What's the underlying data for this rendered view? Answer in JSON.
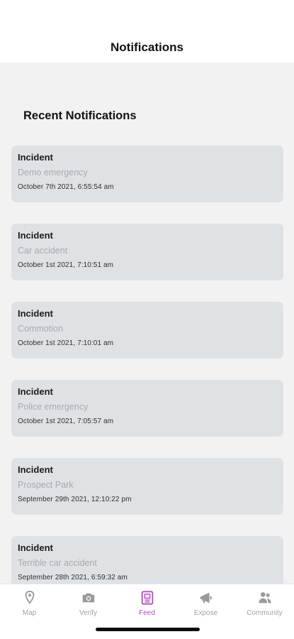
{
  "header": {
    "title": "Notifications"
  },
  "section": {
    "title": "Recent Notifications"
  },
  "notifications": [
    {
      "type": "Incident",
      "description": "Demo emergency",
      "time": "October 7th 2021, 6:55:54 am"
    },
    {
      "type": "Incident",
      "description": "Car accident",
      "time": "October 1st 2021, 7:10:51 am"
    },
    {
      "type": "Incident",
      "description": "Commotion",
      "time": "October 1st 2021, 7:10:01 am"
    },
    {
      "type": "Incident",
      "description": "Police emergency",
      "time": "October 1st 2021, 7:05:57 am"
    },
    {
      "type": "Incident",
      "description": "Prospect Park",
      "time": "September 29th 2021, 12:10:22 pm"
    },
    {
      "type": "Incident",
      "description": "Terrible car accident",
      "time": "September 28th 2021, 6:59:32 am"
    }
  ],
  "tabbar": {
    "active": "Feed",
    "active_color": "#b44cc4",
    "inactive_color": "#a2a2a6",
    "tabs": [
      {
        "label": "Map",
        "icon": "map-pin-icon"
      },
      {
        "label": "Verify",
        "icon": "camera-icon"
      },
      {
        "label": "Feed",
        "icon": "feed-icon"
      },
      {
        "label": "Expose",
        "icon": "megaphone-icon"
      },
      {
        "label": "Community",
        "icon": "people-icon"
      }
    ]
  }
}
